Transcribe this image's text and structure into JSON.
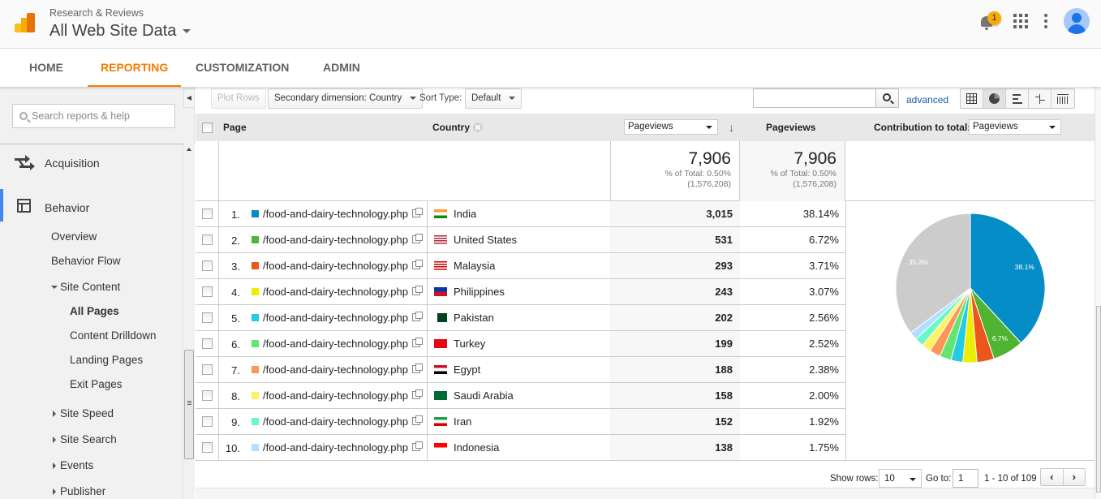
{
  "header": {
    "account": "Research & Reviews",
    "property": "All Web Site Data",
    "notification_count": "1",
    "icons": [
      "analytics-logo-icon",
      "bell-icon",
      "apps-grid-icon",
      "more-vert-icon",
      "account-avatar-icon"
    ]
  },
  "nav": {
    "tabs": [
      {
        "label": "HOME",
        "active": false
      },
      {
        "label": "REPORTING",
        "active": true
      },
      {
        "label": "CUSTOMIZATION",
        "active": false
      },
      {
        "label": "ADMIN",
        "active": false
      }
    ],
    "accent_color": "#f57c00"
  },
  "sidebar": {
    "search_placeholder": "Search reports & help",
    "sections": [
      {
        "label": "Acquisition",
        "icon": "acquisition-arrows-icon"
      },
      {
        "label": "Behavior",
        "icon": "behavior-layout-icon",
        "active": true
      }
    ],
    "behavior_items": [
      "Overview",
      "Behavior Flow"
    ],
    "site_content": {
      "label": "Site Content",
      "expanded": true,
      "items": [
        {
          "label": "All Pages",
          "selected": true
        },
        {
          "label": "Content Drilldown"
        },
        {
          "label": "Landing Pages"
        },
        {
          "label": "Exit Pages"
        }
      ]
    },
    "collapsed_groups": [
      "Site Speed",
      "Site Search",
      "Events",
      "Publisher"
    ]
  },
  "toolbar": {
    "plot_rows": "Plot Rows",
    "secondary_dimension": "Secondary dimension: Country",
    "sort_type_label": "Sort Type:",
    "sort_type_value": "Default",
    "search_value": "",
    "advanced": "advanced",
    "view_modes": [
      "data-table",
      "percentage-pie",
      "performance-bars",
      "comparison",
      "term-cloud-pivot"
    ],
    "active_view": "percentage-pie"
  },
  "table": {
    "headers": {
      "page": "Page",
      "country": "Country",
      "metric_select": "Pageviews",
      "metric_col": "Pageviews",
      "contribution_label": "Contribution to total:",
      "contribution_select": "Pageviews"
    },
    "summary": {
      "pageviews": "7,906",
      "pct_of_total": "% of Total: 0.50%",
      "total": "(1,576,208)",
      "pageviews2": "7,906",
      "pct_of_total2": "% of Total: 0.50%",
      "total2": "(1,576,208)"
    },
    "rows": [
      {
        "num": "1.",
        "page": "/food-and-dairy-technology.php",
        "country": "India",
        "pageviews": "3,015",
        "pct": "38.14%",
        "color": "#058dc7"
      },
      {
        "num": "2.",
        "page": "/food-and-dairy-technology.php",
        "country": "United States",
        "pageviews": "531",
        "pct": "6.72%",
        "color": "#50b432"
      },
      {
        "num": "3.",
        "page": "/food-and-dairy-technology.php",
        "country": "Malaysia",
        "pageviews": "293",
        "pct": "3.71%",
        "color": "#ed561b"
      },
      {
        "num": "4.",
        "page": "/food-and-dairy-technology.php",
        "country": "Philippines",
        "pageviews": "243",
        "pct": "3.07%",
        "color": "#edef00"
      },
      {
        "num": "5.",
        "page": "/food-and-dairy-technology.php",
        "country": "Pakistan",
        "pageviews": "202",
        "pct": "2.56%",
        "color": "#24cbe5"
      },
      {
        "num": "6.",
        "page": "/food-and-dairy-technology.php",
        "country": "Turkey",
        "pageviews": "199",
        "pct": "2.52%",
        "color": "#64e572"
      },
      {
        "num": "7.",
        "page": "/food-and-dairy-technology.php",
        "country": "Egypt",
        "pageviews": "188",
        "pct": "2.38%",
        "color": "#ff9655"
      },
      {
        "num": "8.",
        "page": "/food-and-dairy-technology.php",
        "country": "Saudi Arabia",
        "pageviews": "158",
        "pct": "2.00%",
        "color": "#fff263"
      },
      {
        "num": "9.",
        "page": "/food-and-dairy-technology.php",
        "country": "Iran",
        "pageviews": "152",
        "pct": "1.92%",
        "color": "#6af9c4"
      },
      {
        "num": "10.",
        "page": "/food-and-dairy-technology.php",
        "country": "Indonesia",
        "pageviews": "138",
        "pct": "1.75%",
        "color": "#b2deff"
      }
    ]
  },
  "chart_data": {
    "type": "pie",
    "title": "",
    "categories": [
      "India",
      "United States",
      "Malaysia",
      "Philippines",
      "Pakistan",
      "Turkey",
      "Egypt",
      "Saudi Arabia",
      "Iran",
      "Indonesia",
      "Other"
    ],
    "values": [
      38.14,
      6.72,
      3.71,
      3.07,
      2.56,
      2.52,
      2.38,
      2.0,
      1.92,
      1.75,
      35.23
    ],
    "colors": [
      "#058dc7",
      "#50b432",
      "#ed561b",
      "#edef00",
      "#24cbe5",
      "#64e572",
      "#ff9655",
      "#fff263",
      "#6af9c4",
      "#b2deff",
      "#cccccc"
    ],
    "labels": [
      {
        "slice": 0,
        "text": "38.1%"
      },
      {
        "slice": 1,
        "text": "6.7%"
      },
      {
        "slice": 10,
        "text": "35.3%"
      }
    ],
    "legend": "none"
  },
  "pagination": {
    "show_rows_label": "Show rows:",
    "show_rows_value": "10",
    "goto_label": "Go to:",
    "goto_value": "1",
    "range": "1 - 10 of 109",
    "prev": "‹",
    "next": "›"
  }
}
